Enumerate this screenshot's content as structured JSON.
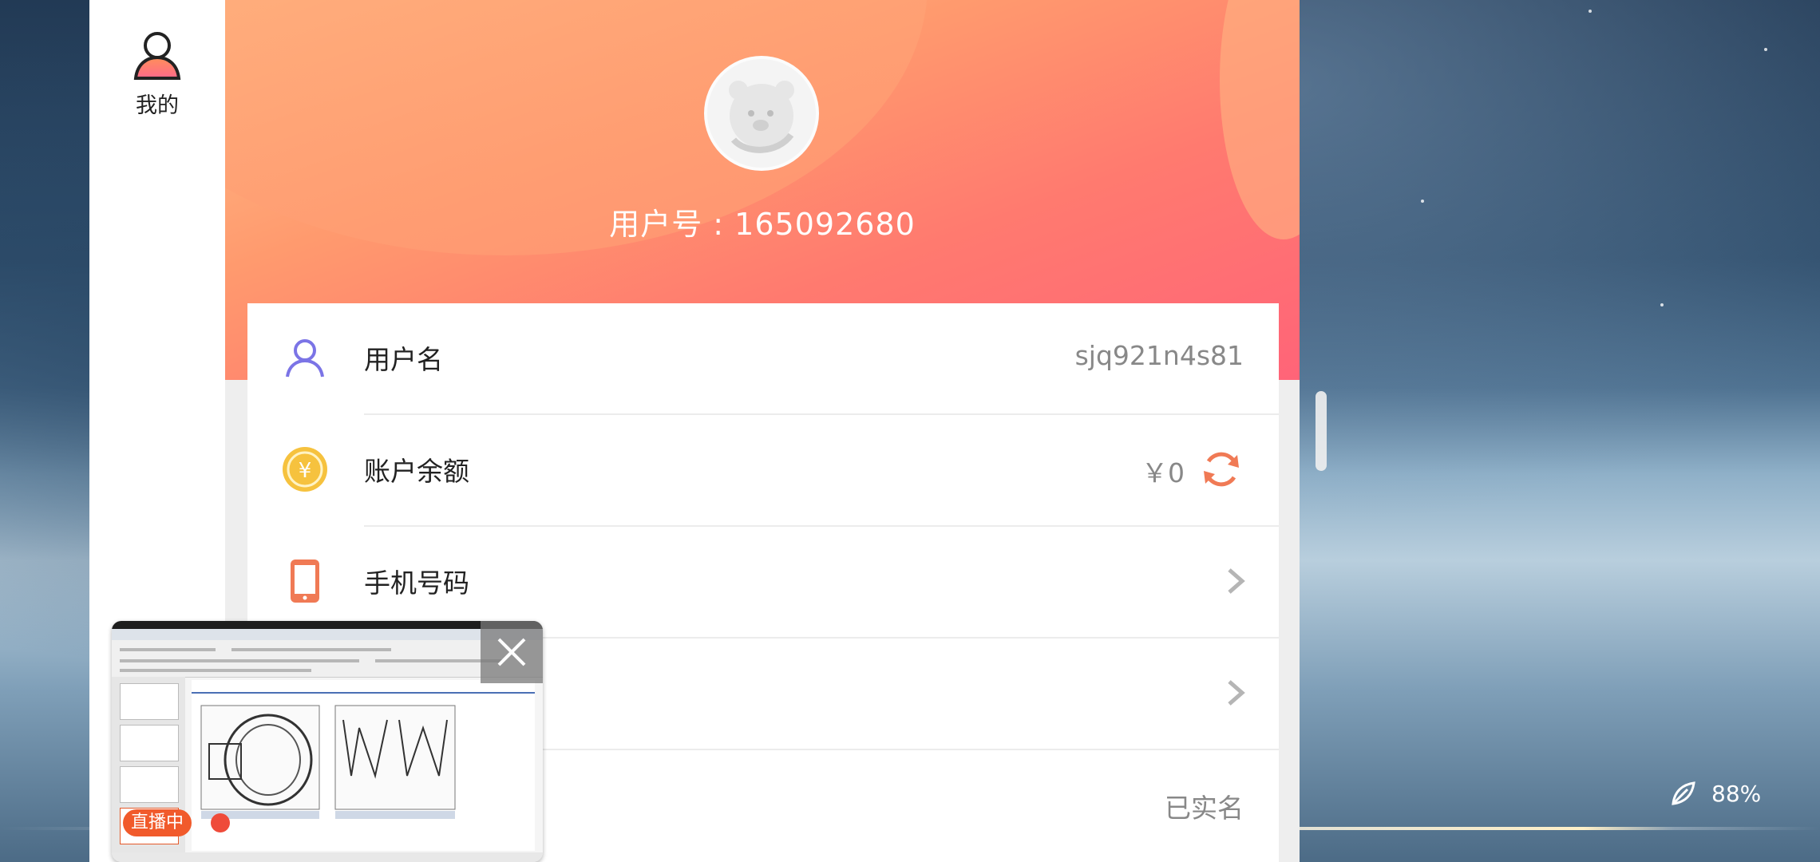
{
  "sidebar": {
    "nav_item_label": "我的"
  },
  "profile": {
    "user_id": "用户号 : 165092680"
  },
  "rows": [
    {
      "label": "用户名",
      "value": "sjq921n4s81"
    },
    {
      "label": "账户余额",
      "value": "￥0"
    },
    {
      "label": "手机号码",
      "value": ""
    },
    {
      "label": "",
      "value": ""
    },
    {
      "label": "",
      "value": "已实名"
    }
  ],
  "pip": {
    "live_label": "直播中"
  },
  "status": {
    "battery": "88%"
  },
  "colors": {
    "accent": "#ff7a6f",
    "user_icon": "#7b74e6",
    "coin": "#f6c23e",
    "phone": "#f07a55"
  }
}
